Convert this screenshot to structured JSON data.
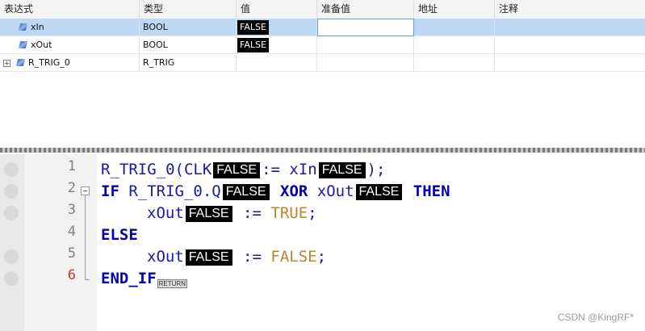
{
  "table": {
    "headers": [
      "表达式",
      "类型",
      "值",
      "准备值",
      "地址",
      "注释"
    ],
    "rows": [
      {
        "expression": "xIn",
        "type": "BOOL",
        "value": "FALSE"
      },
      {
        "expression": "xOut",
        "type": "BOOL",
        "value": "FALSE"
      },
      {
        "expression": "R_TRIG_0",
        "type": "R_TRIG",
        "value": ""
      }
    ],
    "expand_glyph": "+"
  },
  "editor": {
    "line_numbers": [
      "1",
      "2",
      "3",
      "4",
      "5",
      "6"
    ],
    "line1": {
      "a": "R_TRIG_0(CLK",
      "v1": "FALSE",
      "b": ":= xIn",
      "v2": "FALSE",
      "c": ");"
    },
    "line2": {
      "kw_if": "IF",
      "a": " R_TRIG_0.Q",
      "v1": "FALSE",
      "kw_xor": "XOR",
      "b": " xOut",
      "v2": "FALSE",
      "kw_then": "THEN"
    },
    "line3": {
      "a": "xOut",
      "v1": "FALSE",
      "op": ":=",
      "lit": "TRUE",
      "end": ";"
    },
    "line4": {
      "kw": "ELSE"
    },
    "line5": {
      "a": "xOut",
      "v1": "FALSE",
      "op": ":=",
      "lit": "FALSE",
      "end": ";"
    },
    "line6": {
      "kw": "END_IF",
      "badge": "RETURN"
    }
  },
  "watermark": "CSDN @KingRF*",
  "colors": {
    "selection": "#bcd8f4",
    "keyword": "#0000b0",
    "identifier": "#1a1aa6",
    "literal": "#b8862b",
    "value_bg": "#000000"
  }
}
